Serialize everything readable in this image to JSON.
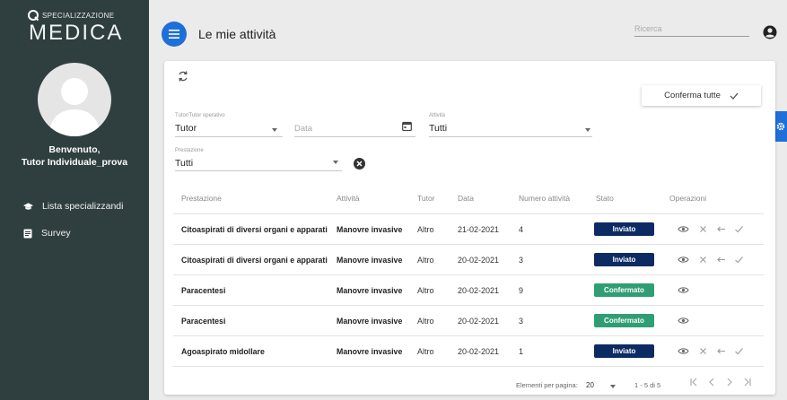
{
  "sidebar": {
    "logo_small": "SPECIALIZZAZIONE",
    "logo_big": "MEDICA",
    "welcome_line1": "Benvenuto,",
    "welcome_line2": "Tutor Individuale_prova",
    "items": [
      {
        "label": "Lista specializzandi",
        "icon": "graduation-cap-icon"
      },
      {
        "label": "Survey",
        "icon": "document-icon"
      }
    ]
  },
  "header": {
    "title": "Le mie attività",
    "search_placeholder": "Ricerca"
  },
  "filters": {
    "tutor_label": "Tutor/Tutor operativo",
    "tutor_value": "Tutor",
    "date_placeholder": "Data",
    "activity_label": "Attività",
    "activity_value": "Tutti",
    "service_label": "Prestazione",
    "service_value": "Tutti"
  },
  "confirm_all_label": "Conferma tutte",
  "table": {
    "headers": [
      "Prestazione",
      "Attività",
      "Tutor",
      "Data",
      "Numero attività",
      "Stato",
      "Operazioni"
    ],
    "rows": [
      {
        "prestazione": "Citoaspirati di diversi organi e apparati",
        "attivita": "Manovre invasive",
        "tutor": "Altro",
        "data": "21-02-2021",
        "numero": "4",
        "stato": "Inviato"
      },
      {
        "prestazione": "Citoaspirati di diversi organi e apparati",
        "attivita": "Manovre invasive",
        "tutor": "Altro",
        "data": "20-02-2021",
        "numero": "3",
        "stato": "Inviato"
      },
      {
        "prestazione": "Paracentesi",
        "attivita": "Manovre invasive",
        "tutor": "Altro",
        "data": "20-02-2021",
        "numero": "9",
        "stato": "Confermato"
      },
      {
        "prestazione": "Paracentesi",
        "attivita": "Manovre invasive",
        "tutor": "Altro",
        "data": "20-02-2021",
        "numero": "3",
        "stato": "Confermato"
      },
      {
        "prestazione": "Agoaspirato midollare",
        "attivita": "Manovre invasive",
        "tutor": "Altro",
        "data": "20-02-2021",
        "numero": "1",
        "stato": "Inviato"
      }
    ]
  },
  "pagination": {
    "per_page_label": "Elementi per pagina:",
    "per_page_value": "20",
    "range": "1 - 5 di 5"
  },
  "colors": {
    "sidebar": "#2f3f3f",
    "accent": "#1e6fd9",
    "inviato": "#0d2b63",
    "confermato": "#2f9e75"
  }
}
